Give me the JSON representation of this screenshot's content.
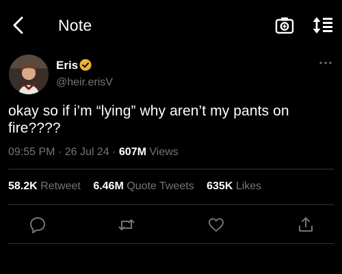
{
  "header": {
    "title": "Note"
  },
  "tweet": {
    "author_name": "Eris",
    "author_handle": "@heir.erisV",
    "text": "okay so if i’m “lying” why aren’t my pants on fire????",
    "time": "09:55 PM",
    "date": "26 Jul 24",
    "views_count": "607M",
    "views_label": "Views"
  },
  "stats": {
    "retweets_count": "58.2K",
    "retweets_label": "Retweet",
    "quotes_count": "6.46M",
    "quotes_label": "Quote Tweets",
    "likes_count": "635K",
    "likes_label": "Likes"
  },
  "colors": {
    "background": "#000000",
    "text": "#ffffff",
    "secondary": "#71767b",
    "verified": "#e8b339",
    "divider": "#2f3336"
  },
  "icons": [
    "back-chevron-icon",
    "camera-icon",
    "sort-icon",
    "verified-badge-icon",
    "more-icon",
    "reply-icon",
    "retweet-icon",
    "like-icon",
    "share-icon"
  ]
}
